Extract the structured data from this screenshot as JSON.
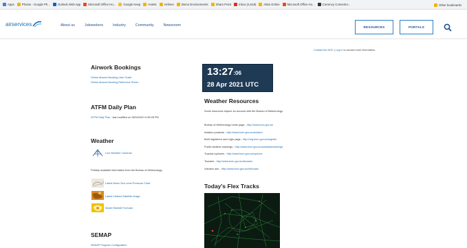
{
  "bookmarks": [
    {
      "label": "Apps",
      "color": "#4a7bd0"
    },
    {
      "label": "Photos - Google Ph...",
      "color": "#f4b400"
    },
    {
      "label": "Outlook Web App",
      "color": "#0a64c8"
    },
    {
      "label": "Microsoft Office Ho...",
      "color": "#e8491d"
    },
    {
      "label": "Google Keep",
      "color": "#f6bf26"
    },
    {
      "label": "Hotels",
      "color": "#f4b400"
    },
    {
      "label": "Airlines",
      "color": "#f4b400"
    },
    {
      "label": "Demo Environments",
      "color": "#f4b400"
    },
    {
      "label": "Share Point",
      "color": "#f4b400"
    },
    {
      "label": "Inbox (4,518)",
      "color": "#d93025"
    },
    {
      "label": "Atlas Online",
      "color": "#f4b400"
    },
    {
      "label": "Microsoft Office Ho...",
      "color": "#e8491d"
    },
    {
      "label": "Currency Converter...",
      "color": "#333333"
    }
  ],
  "bookmarks_right": [
    "Other bookmarks"
  ],
  "header": {
    "logo_text": "airservices",
    "nav": [
      "About us",
      "Jobseekers",
      "Industry",
      "Community",
      "Newsroom"
    ],
    "resources_label": "RESOURCES",
    "portals_label": "PORTALS"
  },
  "top_link": {
    "link": "Contact the NOC",
    "sep": " | ",
    "login": "Log in",
    "rest": " to access more information."
  },
  "clock": {
    "time": "13:27",
    "seconds": ":06",
    "date": "28 Apr 2021 UTC"
  },
  "airwork": {
    "title": "Airwork Bookings",
    "links": [
      "Online Airwork Booking User Guide",
      "Online Airwork Booking Reference Sheet"
    ]
  },
  "atfm": {
    "title": "ATFM Daily Plan",
    "link": "ATFM Daily Plan",
    "modified": " - last modified on 28/04/2021 5:59:26 PM"
  },
  "weather": {
    "title": "Weather",
    "cameras": "Live Weather Cameras",
    "public_info": "Publicly available information from the Bureau of Meteorology:",
    "items": [
      "Latest Mean Sea Level Pressure Chart",
      "Latest Infrared Satellite Image",
      "Model Rainfall Forecast"
    ]
  },
  "semap": {
    "title": "SEMAP",
    "link": "SEMAP Program Configuration"
  },
  "weather_resources": {
    "title": "Weather Resources",
    "intro": "Some resources require an account with the Bureau of Meteorology.",
    "rows": [
      {
        "label": "Bureau of Meteorology home page - ",
        "url": "http://www.bom.gov.au"
      },
      {
        "label": "Aviation products - ",
        "url": "http://www.bom.gov.au/aviation"
      },
      {
        "label": "BoM registered user login page - ",
        "url": "http://reg.bom.gov.au/register"
      },
      {
        "label": "Public weather warnings - ",
        "url": "http://www.bom.gov.au/australia/warnings"
      },
      {
        "label": "Tropical cyclones - ",
        "url": "http://www.bom.gov.au/cyclone"
      },
      {
        "label": "Tsunami - ",
        "url": "http://www.bom.gov.au/tsunami"
      },
      {
        "label": "Volcanic ash - ",
        "url": "http://www.bom.gov.au/info/vaac"
      }
    ]
  },
  "flex": {
    "title": "Today's Flex Tracks"
  },
  "colors": {
    "brand": "#1a6db3",
    "nav": "#1c4f8f",
    "clock_bg": "#1e3a55"
  }
}
